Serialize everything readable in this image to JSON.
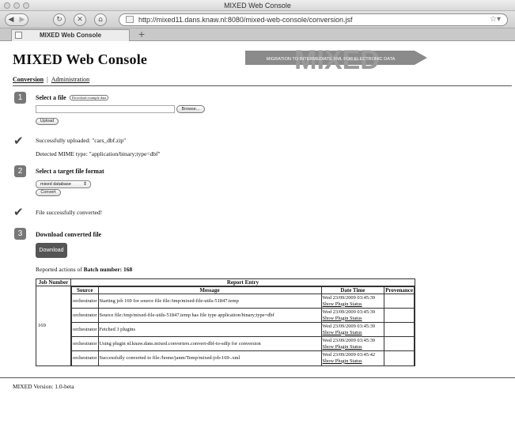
{
  "window": {
    "title": "MIXED Web Console"
  },
  "browser": {
    "url": "http://mixed11.dans.knaw.nl:8080/mixed-web-console/conversion.jsf",
    "tab_label": "MIXED Web Console",
    "new_tab": "+"
  },
  "header": {
    "site_title": "MIXED Web Console",
    "banner_text": "MIXED",
    "banner_tagline": "MIGRATION TO INTERMEDIATE XML FOR ELECTRONIC DATA"
  },
  "nav": {
    "conversion": "Conversion",
    "separator": "|",
    "administration": "Administration"
  },
  "step1": {
    "number": "1",
    "heading": "Select a file",
    "example_link": "Download example data",
    "browse_label": "Browse...",
    "upload_label": "Upload",
    "uploaded_message": "Successfully uploaded: \"cars_dbf.zip\"",
    "mime_message": "Detected MIME type: \"application/binary;type=dbf\""
  },
  "step2": {
    "number": "2",
    "heading": "Select a target file format",
    "format_selected": "mixed database",
    "convert_label": "Convert",
    "converted_message": "File successfully converted!"
  },
  "step3": {
    "number": "3",
    "heading": "Download converted file",
    "download_label": "Download",
    "batch_prefix": "Reported actions of",
    "batch_label": "Batch number",
    "batch_number": "168"
  },
  "report": {
    "col_job": "Job Number",
    "col_entry": "Report Entry",
    "col_source": "Source",
    "col_message": "Message",
    "col_datetime": "Date Time",
    "col_provenance": "Provenance",
    "job_number": "169",
    "show_plugin": "Show Plugin Status",
    "rows": [
      {
        "source": "orchestrator",
        "message": "Starting job 169 for source file file:/tmp/mixed-file-utils-51847.temp",
        "datetime": "Wed 23/09/2009 03:45:39"
      },
      {
        "source": "orchestrator",
        "message": "Source file:/tmp/mixed-file-utils-51847.temp has file type application/binary;type=dbf",
        "datetime": "Wed 23/09/2009 03:45:39"
      },
      {
        "source": "orchestrator",
        "message": "Fetched 3 plugins",
        "datetime": "Wed 23/09/2009 03:45:39"
      },
      {
        "source": "orchestrator",
        "message": "Using plugin nl.knaw.dans.mixed.converters.convert-dbf-to-sdfp for conversion",
        "datetime": "Wed 23/09/2009 03:45:39"
      },
      {
        "source": "orchestrator",
        "message": "Successfully converted to file:/home/janm/Temp/mixed-job-169-.xml",
        "datetime": "Wed 23/09/2009 03:45:42"
      }
    ]
  },
  "footer": {
    "version": "MIXED Version: 1.0-beta"
  },
  "colors": {
    "badge": "#777777",
    "download_button": "#555555",
    "banner": "#8a8a8a"
  }
}
